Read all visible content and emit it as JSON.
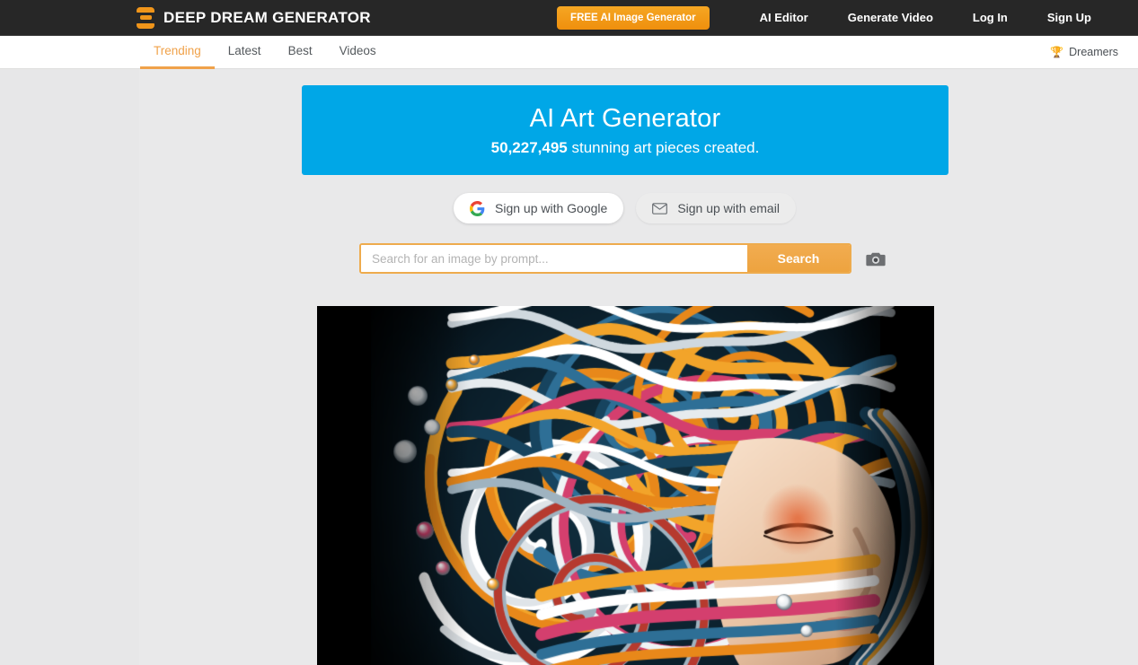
{
  "header": {
    "brand_name": "DEEP DREAM GENERATOR",
    "logo_icon": "stacked-bars-icon",
    "cta_label": "FREE AI Image Generator",
    "links": [
      {
        "label": "AI Editor"
      },
      {
        "label": "Generate Video"
      },
      {
        "label": "Log In"
      },
      {
        "label": "Sign Up"
      }
    ],
    "accent_color": "#f0951a",
    "background_color": "#272727"
  },
  "subnav": {
    "tabs": [
      {
        "label": "Trending",
        "active": true
      },
      {
        "label": "Latest",
        "active": false
      },
      {
        "label": "Best",
        "active": false
      },
      {
        "label": "Videos",
        "active": false
      }
    ],
    "dreamers": {
      "icon": "trophy-icon",
      "label": "Dreamers"
    },
    "active_color": "#f0a24a"
  },
  "hero": {
    "title": "AI Art Generator",
    "count": "50,227,495",
    "subtitle_rest": " stunning art pieces created.",
    "background_color": "#00a7e7"
  },
  "signup": {
    "google": {
      "icon": "google-g-icon",
      "label": "Sign up with Google"
    },
    "email": {
      "icon": "envelope-icon",
      "label": "Sign up with email"
    }
  },
  "search": {
    "placeholder": "Search for an image by prompt...",
    "value": "",
    "submit_label": "Search",
    "camera_icon": "camera-icon",
    "border_color": "#eeab4d"
  },
  "artwork": {
    "alt": "Colorful swirling liquid-paint portrait of a woman's face on black background",
    "background_color": "#000000"
  }
}
